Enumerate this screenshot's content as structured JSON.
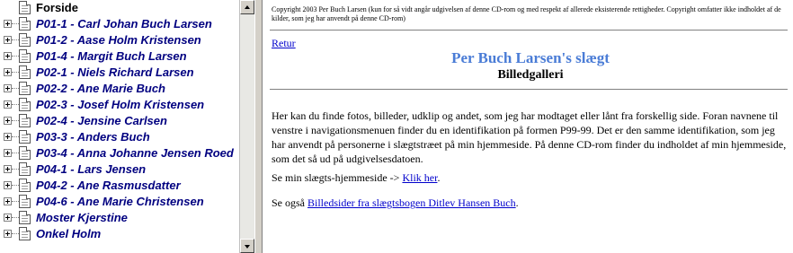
{
  "tree": {
    "root_label": "Forside",
    "items": [
      {
        "label": "P01-1 - Carl Johan Buch Larsen"
      },
      {
        "label": "P01-2 - Aase Holm Kristensen"
      },
      {
        "label": "P01-4 - Margit Buch Larsen"
      },
      {
        "label": "P02-1 - Niels Richard Larsen"
      },
      {
        "label": "P02-2 - Ane Marie Buch"
      },
      {
        "label": "P02-3 - Josef Holm Kristensen"
      },
      {
        "label": "P02-4 - Jensine Carlsen"
      },
      {
        "label": "P03-3 - Anders Buch"
      },
      {
        "label": "P03-4 - Anna Johanne Jensen Roed"
      },
      {
        "label": "P04-1 - Lars Jensen"
      },
      {
        "label": "P04-2 - Ane Rasmusdatter"
      },
      {
        "label": "P04-6 - Ane Marie Christensen"
      },
      {
        "label": "Moster Kjerstine"
      },
      {
        "label": "Onkel Holm"
      }
    ]
  },
  "content": {
    "copyright": "Copyright 2003 Per Buch Larsen (kun for så vidt angår udgivelsen af denne CD-rom og med respekt af allerede eksisterende rettigheder. Copyright omfatter ikke indholdet af de kilder, som jeg har anvendt på denne CD-rom)",
    "back_link": "Retur",
    "title": "Per Buch Larsen's slægt",
    "subtitle": "Billedgalleri",
    "intro": "Her kan du finde fotos, billeder, udklip og andet, som jeg har modtaget eller lånt fra forskellig side. Foran navnene til venstre i navigationsmenuen finder du en identifikation på formen P99-99. Det er den samme identifikation, som jeg har anvendt på personerne i slægtstræet på min hjemmeside. På denne CD-rom finder du indholdet af min hjemmeside, som det så ud på udgivelsesdatoen.",
    "homepage_prefix": "Se min slægts-hjemmeside -> ",
    "homepage_link": "Klik her",
    "homepage_suffix": ".",
    "see_also_prefix": "Se også ",
    "see_also_link": "Billedsider fra slægtsbogen Ditlev Hansen Buch",
    "see_also_suffix": "."
  },
  "colors": {
    "tree_text": "#000080",
    "title": "#4a7cd6",
    "link": "#0000cc"
  }
}
